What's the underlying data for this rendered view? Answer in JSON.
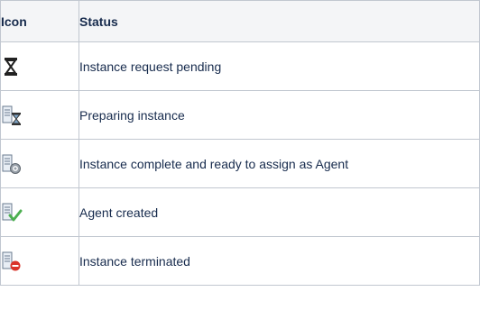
{
  "table": {
    "headers": {
      "icon": "Icon",
      "status": "Status"
    },
    "rows": [
      {
        "icon": "hourglass-icon",
        "status": "Instance request pending"
      },
      {
        "icon": "server-hourglass-icon",
        "status": "Preparing instance"
      },
      {
        "icon": "server-pending-icon",
        "status": "Instance complete and ready to assign as Agent"
      },
      {
        "icon": "server-check-icon",
        "status": "Agent created"
      },
      {
        "icon": "server-stop-icon",
        "status": "Instance terminated"
      }
    ]
  },
  "colors": {
    "border": "#c1c7d0",
    "header_bg": "#f4f5f7",
    "text": "#172b4d",
    "check_green": "#4caf50",
    "stop_red": "#d9342b"
  }
}
